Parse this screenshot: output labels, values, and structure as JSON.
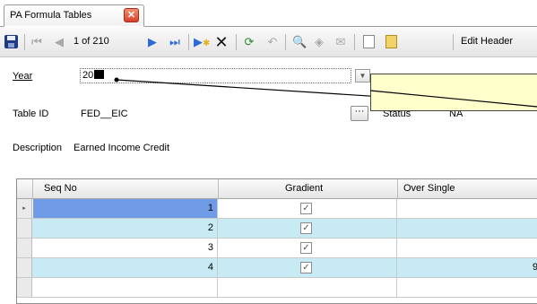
{
  "tab": {
    "title": "PA Formula Tables",
    "close_symbol": "✕"
  },
  "toolbar": {
    "record_position": "1 of 210",
    "edit_header_label": "Edit Header"
  },
  "form": {
    "year": {
      "label": "Year",
      "value": "20"
    },
    "table_id": {
      "label": "Table ID",
      "value": "FED__EIC",
      "lookup_label": "···"
    },
    "status": {
      "label": "Status",
      "value": "NA"
    },
    "description": {
      "label": "Description",
      "value": "Earned Income Credit"
    }
  },
  "grid": {
    "columns": [
      "Seq No",
      "Gradient",
      "Over Single"
    ],
    "rows": [
      {
        "seq_no": "1",
        "gradient": true
      },
      {
        "seq_no": "2",
        "gradient": true
      },
      {
        "seq_no": "3",
        "gradient": true
      },
      {
        "seq_no": "4",
        "gradient": true,
        "trailing": "9"
      }
    ],
    "row_pointer": "▸",
    "check_mark": "✓"
  },
  "colors": {
    "alt_row": "#c8eaf4",
    "selected_cell": "#6f9ae5",
    "callout_fill": "#ffffcc",
    "tab_close": "#d9402a"
  }
}
